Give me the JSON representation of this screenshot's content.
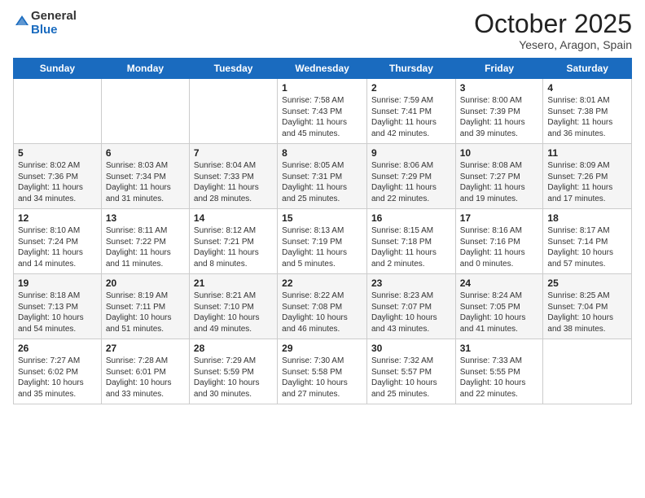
{
  "header": {
    "logo_line1": "General",
    "logo_line2": "Blue",
    "title": "October 2025",
    "subtitle": "Yesero, Aragon, Spain"
  },
  "weekdays": [
    "Sunday",
    "Monday",
    "Tuesday",
    "Wednesday",
    "Thursday",
    "Friday",
    "Saturday"
  ],
  "weeks": [
    [
      {
        "day": "",
        "info": ""
      },
      {
        "day": "",
        "info": ""
      },
      {
        "day": "",
        "info": ""
      },
      {
        "day": "1",
        "info": "Sunrise: 7:58 AM\nSunset: 7:43 PM\nDaylight: 11 hours\nand 45 minutes."
      },
      {
        "day": "2",
        "info": "Sunrise: 7:59 AM\nSunset: 7:41 PM\nDaylight: 11 hours\nand 42 minutes."
      },
      {
        "day": "3",
        "info": "Sunrise: 8:00 AM\nSunset: 7:39 PM\nDaylight: 11 hours\nand 39 minutes."
      },
      {
        "day": "4",
        "info": "Sunrise: 8:01 AM\nSunset: 7:38 PM\nDaylight: 11 hours\nand 36 minutes."
      }
    ],
    [
      {
        "day": "5",
        "info": "Sunrise: 8:02 AM\nSunset: 7:36 PM\nDaylight: 11 hours\nand 34 minutes."
      },
      {
        "day": "6",
        "info": "Sunrise: 8:03 AM\nSunset: 7:34 PM\nDaylight: 11 hours\nand 31 minutes."
      },
      {
        "day": "7",
        "info": "Sunrise: 8:04 AM\nSunset: 7:33 PM\nDaylight: 11 hours\nand 28 minutes."
      },
      {
        "day": "8",
        "info": "Sunrise: 8:05 AM\nSunset: 7:31 PM\nDaylight: 11 hours\nand 25 minutes."
      },
      {
        "day": "9",
        "info": "Sunrise: 8:06 AM\nSunset: 7:29 PM\nDaylight: 11 hours\nand 22 minutes."
      },
      {
        "day": "10",
        "info": "Sunrise: 8:08 AM\nSunset: 7:27 PM\nDaylight: 11 hours\nand 19 minutes."
      },
      {
        "day": "11",
        "info": "Sunrise: 8:09 AM\nSunset: 7:26 PM\nDaylight: 11 hours\nand 17 minutes."
      }
    ],
    [
      {
        "day": "12",
        "info": "Sunrise: 8:10 AM\nSunset: 7:24 PM\nDaylight: 11 hours\nand 14 minutes."
      },
      {
        "day": "13",
        "info": "Sunrise: 8:11 AM\nSunset: 7:22 PM\nDaylight: 11 hours\nand 11 minutes."
      },
      {
        "day": "14",
        "info": "Sunrise: 8:12 AM\nSunset: 7:21 PM\nDaylight: 11 hours\nand 8 minutes."
      },
      {
        "day": "15",
        "info": "Sunrise: 8:13 AM\nSunset: 7:19 PM\nDaylight: 11 hours\nand 5 minutes."
      },
      {
        "day": "16",
        "info": "Sunrise: 8:15 AM\nSunset: 7:18 PM\nDaylight: 11 hours\nand 2 minutes."
      },
      {
        "day": "17",
        "info": "Sunrise: 8:16 AM\nSunset: 7:16 PM\nDaylight: 11 hours\nand 0 minutes."
      },
      {
        "day": "18",
        "info": "Sunrise: 8:17 AM\nSunset: 7:14 PM\nDaylight: 10 hours\nand 57 minutes."
      }
    ],
    [
      {
        "day": "19",
        "info": "Sunrise: 8:18 AM\nSunset: 7:13 PM\nDaylight: 10 hours\nand 54 minutes."
      },
      {
        "day": "20",
        "info": "Sunrise: 8:19 AM\nSunset: 7:11 PM\nDaylight: 10 hours\nand 51 minutes."
      },
      {
        "day": "21",
        "info": "Sunrise: 8:21 AM\nSunset: 7:10 PM\nDaylight: 10 hours\nand 49 minutes."
      },
      {
        "day": "22",
        "info": "Sunrise: 8:22 AM\nSunset: 7:08 PM\nDaylight: 10 hours\nand 46 minutes."
      },
      {
        "day": "23",
        "info": "Sunrise: 8:23 AM\nSunset: 7:07 PM\nDaylight: 10 hours\nand 43 minutes."
      },
      {
        "day": "24",
        "info": "Sunrise: 8:24 AM\nSunset: 7:05 PM\nDaylight: 10 hours\nand 41 minutes."
      },
      {
        "day": "25",
        "info": "Sunrise: 8:25 AM\nSunset: 7:04 PM\nDaylight: 10 hours\nand 38 minutes."
      }
    ],
    [
      {
        "day": "26",
        "info": "Sunrise: 7:27 AM\nSunset: 6:02 PM\nDaylight: 10 hours\nand 35 minutes."
      },
      {
        "day": "27",
        "info": "Sunrise: 7:28 AM\nSunset: 6:01 PM\nDaylight: 10 hours\nand 33 minutes."
      },
      {
        "day": "28",
        "info": "Sunrise: 7:29 AM\nSunset: 5:59 PM\nDaylight: 10 hours\nand 30 minutes."
      },
      {
        "day": "29",
        "info": "Sunrise: 7:30 AM\nSunset: 5:58 PM\nDaylight: 10 hours\nand 27 minutes."
      },
      {
        "day": "30",
        "info": "Sunrise: 7:32 AM\nSunset: 5:57 PM\nDaylight: 10 hours\nand 25 minutes."
      },
      {
        "day": "31",
        "info": "Sunrise: 7:33 AM\nSunset: 5:55 PM\nDaylight: 10 hours\nand 22 minutes."
      },
      {
        "day": "",
        "info": ""
      }
    ]
  ]
}
